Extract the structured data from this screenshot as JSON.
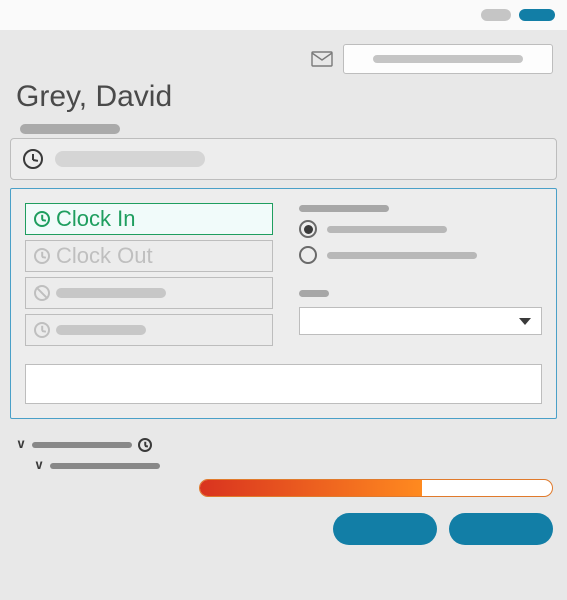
{
  "titlebar": {
    "button_grey": "",
    "button_blue": ""
  },
  "toolbar": {
    "mail_icon": "mail",
    "search_placeholder": ""
  },
  "page": {
    "title": "Grey, David"
  },
  "tab": {
    "label": ""
  },
  "actions": [
    {
      "id": "clock-in",
      "label": "Clock In",
      "icon": "clock",
      "state": "active"
    },
    {
      "id": "clock-out",
      "label": "Clock Out",
      "icon": "clock",
      "state": "disabled"
    },
    {
      "id": "cancel",
      "label": "",
      "icon": "ban",
      "state": "disabled"
    },
    {
      "id": "time-entry",
      "label": "",
      "icon": "clock",
      "state": "disabled"
    }
  ],
  "options": {
    "section_label": "",
    "radios": [
      {
        "label": "",
        "checked": true
      },
      {
        "label": "",
        "checked": false
      }
    ],
    "select_label": "",
    "select_value": ""
  },
  "note": {
    "value": ""
  },
  "tree": {
    "parent_label": "",
    "parent_icon": "clock",
    "child_label": ""
  },
  "progress": {
    "percent": 63
  },
  "footer": {
    "primary": "",
    "secondary": ""
  },
  "colors": {
    "accent_blue": "#127ea6",
    "active_green": "#1f9e5f",
    "progress_start": "#d9331f",
    "progress_end": "#ff8a1f"
  }
}
